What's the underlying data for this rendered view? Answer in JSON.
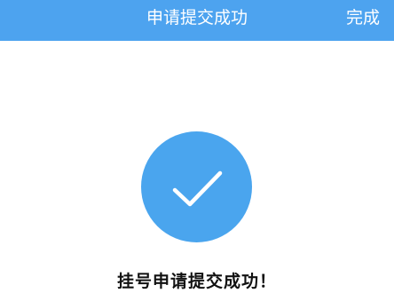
{
  "header": {
    "title": "申请提交成功",
    "done_label": "完成"
  },
  "main": {
    "status_icon": "check-icon",
    "message": "挂号申请提交成功！"
  },
  "colors": {
    "nav_background": "#4da3ef",
    "icon_circle": "#4aa5ee",
    "nav_text": "#ffffff",
    "message_text": "#111111"
  }
}
